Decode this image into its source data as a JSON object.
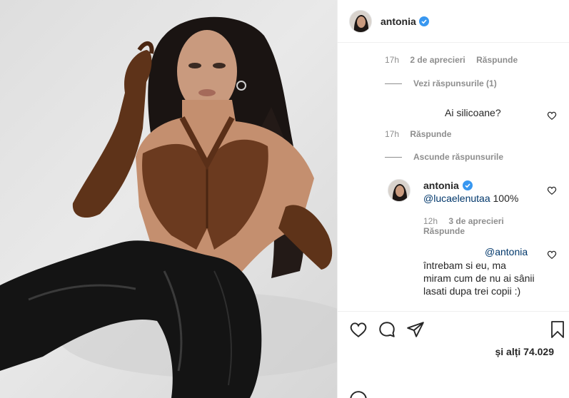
{
  "post": {
    "photo_alt": "antonia",
    "author": {
      "username": "antonia",
      "verified": true
    }
  },
  "comments": {
    "first_meta": {
      "time": "17h",
      "likes": "2 de aprecieri",
      "reply": "Răspunde"
    },
    "view_replies": "Vezi răspunsurile (1)",
    "question": {
      "text": "Ai silicoane?",
      "time": "17h",
      "reply": "Răspunde"
    },
    "hide_replies": "Ascunde răspunsurile",
    "reply_1": {
      "username": "antonia",
      "mention": "@lucaelenutaa",
      "text": "100%",
      "time": "12h",
      "likes": "3 de aprecieri",
      "reply": "Răspunde"
    },
    "reply_2": {
      "mention": "@antonia",
      "line1": "întrebam si eu, ma",
      "line2": "miram cum de nu ai sânii",
      "line3": "lasati dupa trei copii :)"
    }
  },
  "actions": {
    "like_icon": "heart-icon",
    "comment_icon": "comment-icon",
    "share_icon": "share-icon",
    "save_icon": "bookmark-icon",
    "likes_text": "și alți 74.029"
  },
  "colors": {
    "verified": "#3897f0",
    "mention": "#00376b",
    "muted": "#8e8e8e",
    "text": "#262626"
  }
}
